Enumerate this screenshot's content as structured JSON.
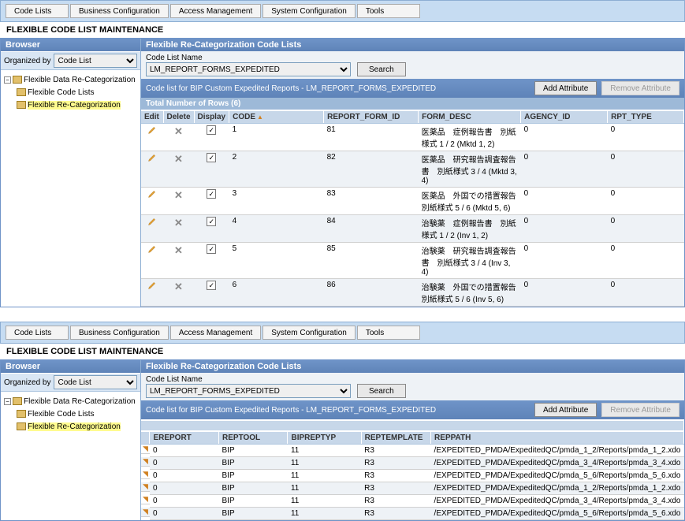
{
  "tabs": {
    "codeLists": "Code Lists",
    "bizConfig": "Business Configuration",
    "accessMgmt": "Access Management",
    "sysConfig": "System Configuration",
    "tools": "Tools"
  },
  "pageTitle": "FLEXIBLE CODE LIST MAINTENANCE",
  "browser": {
    "title": "Browser",
    "orgBy": "Organized by",
    "orgVal": "Code List",
    "tree": {
      "root": "Flexible Data Re-Categorization",
      "n1": "Flexible Code Lists",
      "n2": "Flexible Re-Categorization"
    }
  },
  "panelA": {
    "hdr": "Flexible Re-Categorization Code Lists",
    "nameLbl": "Code List Name",
    "nameVal": "LM_REPORT_FORMS_EXPEDITED",
    "searchBtn": "Search",
    "detailHdr": "Code list for BIP Custom Expedited Reports - LM_REPORT_FORMS_EXPEDITED",
    "addBtn": "Add Attribute",
    "removeBtn": "Remove Attribute",
    "countHdr": "Total Number of Rows (6)",
    "columns": {
      "edit": "Edit",
      "del": "Delete",
      "disp": "Display",
      "code": "CODE",
      "rfid": "REPORT_FORM_ID",
      "fdesc": "FORM_DESC",
      "aid": "AGENCY_ID",
      "rtype": "RPT_TYPE"
    },
    "rows": [
      {
        "code": "1",
        "rfid": "81",
        "fdesc": "医薬品　症例報告書　別紙様式 1 / 2  (Mktd 1, 2)",
        "aid": "0",
        "rtype": "0"
      },
      {
        "code": "2",
        "rfid": "82",
        "fdesc": "医薬品　研究報告調査報告書　別紙様式 3 / 4  (Mktd 3, 4)",
        "aid": "0",
        "rtype": "0"
      },
      {
        "code": "3",
        "rfid": "83",
        "fdesc": "医薬品　外国での措置報告　別紙様式 5 / 6  (Mktd 5, 6)",
        "aid": "0",
        "rtype": "0"
      },
      {
        "code": "4",
        "rfid": "84",
        "fdesc": "治験薬　症例報告書　別紙様式 1 / 2  (Inv 1, 2)",
        "aid": "0",
        "rtype": "0"
      },
      {
        "code": "5",
        "rfid": "85",
        "fdesc": "治験薬　研究報告調査報告書　別紙様式 3 / 4  (Inv 3, 4)",
        "aid": "0",
        "rtype": "0"
      },
      {
        "code": "6",
        "rfid": "86",
        "fdesc": "治験薬　外国での措置報告　別紙様式 5 / 6  (Inv 5, 6)",
        "aid": "0",
        "rtype": "0"
      }
    ]
  },
  "panelB": {
    "hdr": "Flexible Re-Categorization Code Lists",
    "nameLbl": "Code List Name",
    "nameVal": "LM_REPORT_FORMS_EXPEDITED",
    "searchBtn": "Search",
    "detailHdr": "Code list for BIP Custom Expedited Reports - LM_REPORT_FORMS_EXPEDITED",
    "addBtn": "Add Attribute",
    "removeBtn": "Remove Attribute",
    "columns": {
      "erep": "EREPORT",
      "tool": "REPTOOL",
      "btyp": "BIPREPTYP",
      "tmpl": "REPTEMPLATE",
      "path": "REPPATH"
    },
    "rows": [
      {
        "erep": "0",
        "tool": "BIP",
        "btyp": "11",
        "tmpl": "R3",
        "path": "/EXPEDITED_PMDA/ExpeditedQC/pmda_1_2/Reports/pmda_1_2.xdo"
      },
      {
        "erep": "0",
        "tool": "BIP",
        "btyp": "11",
        "tmpl": "R3",
        "path": "/EXPEDITED_PMDA/ExpeditedQC/pmda_3_4/Reports/pmda_3_4.xdo"
      },
      {
        "erep": "0",
        "tool": "BIP",
        "btyp": "11",
        "tmpl": "R3",
        "path": "/EXPEDITED_PMDA/ExpeditedQC/pmda_5_6/Reports/pmda_5_6.xdo"
      },
      {
        "erep": "0",
        "tool": "BIP",
        "btyp": "11",
        "tmpl": "R3",
        "path": "/EXPEDITED_PMDA/ExpeditedQC/pmda_1_2/Reports/pmda_1_2.xdo"
      },
      {
        "erep": "0",
        "tool": "BIP",
        "btyp": "11",
        "tmpl": "R3",
        "path": "/EXPEDITED_PMDA/ExpeditedQC/pmda_3_4/Reports/pmda_3_4.xdo"
      },
      {
        "erep": "0",
        "tool": "BIP",
        "btyp": "11",
        "tmpl": "R3",
        "path": "/EXPEDITED_PMDA/ExpeditedQC/pmda_5_6/Reports/pmda_5_6.xdo"
      }
    ]
  }
}
